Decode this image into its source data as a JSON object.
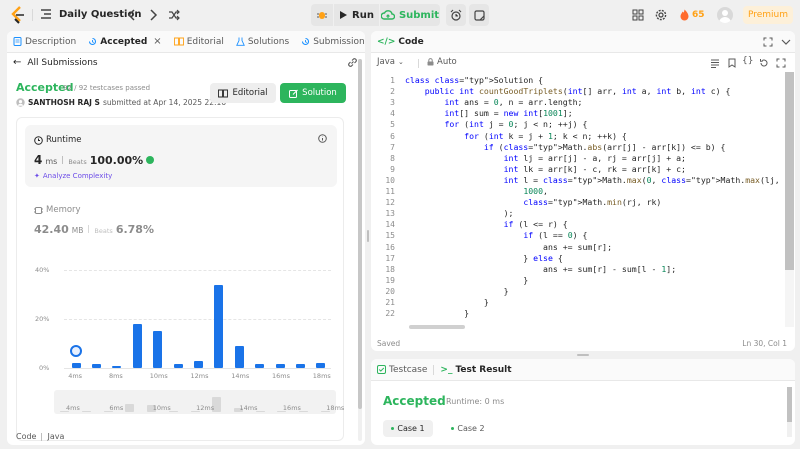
{
  "header": {
    "title": "Daily Question",
    "run_label": "Run",
    "submit_label": "Submit",
    "streak": "65",
    "premium_label": "Premium",
    "accent": "#ffa116"
  },
  "left": {
    "tabs": [
      {
        "label": "Description"
      },
      {
        "label": "Accepted"
      },
      {
        "label": "Editorial"
      },
      {
        "label": "Solutions"
      },
      {
        "label": "Submissions"
      }
    ],
    "back_label": "All Submissions",
    "status": "Accepted",
    "passed": "92 / 92 testcases passed",
    "user": "SANTHOSH RAJ S",
    "submitted": "submitted at Apr 14, 2025 22:16",
    "editorial_btn": "Editorial",
    "solution_btn": "Solution",
    "runtime": {
      "label": "Runtime",
      "value": "4",
      "unit": "ms",
      "beats_label": "Beats",
      "beats": "100.00%",
      "analyze": "Analyze Complexity"
    },
    "memory": {
      "label": "Memory",
      "value": "42.40",
      "unit": "MB",
      "beats_label": "Beats",
      "beats": "6.78%"
    },
    "footer": {
      "code_label": "Code",
      "lang": "Java"
    }
  },
  "chart_data": {
    "type": "bar",
    "y_ticks": [
      "40%",
      "20%",
      "0%"
    ],
    "ylim": [
      0,
      40
    ],
    "x_ticks": [
      "4ms",
      "8ms",
      "10ms",
      "12ms",
      "14ms",
      "16ms",
      "18ms"
    ],
    "values": [
      2,
      1.5,
      1,
      18,
      15,
      1.5,
      3,
      34,
      9,
      1.5,
      1.5,
      1.5,
      2
    ],
    "highlight_index": 0,
    "brush_ticks": [
      "4ms",
      "6ms",
      "10ms",
      "12ms",
      "14ms",
      "16ms",
      "18ms"
    ],
    "bar_color": "#1a73e8"
  },
  "code": {
    "title": "Code",
    "lang": "Java",
    "mode": "Auto",
    "lines": [
      "class Solution {",
      "    public int countGoodTriplets(int[] arr, int a, int b, int c) {",
      "        int ans = 0, n = arr.length;",
      "        int[] sum = new int[1001];",
      "        for (int j = 0; j < n; ++j) {",
      "            for (int k = j + 1; k < n; ++k) {",
      "                if (Math.abs(arr[j] - arr[k]) <= b) {",
      "                    int lj = arr[j] - a, rj = arr[j] + a;",
      "                    int lk = arr[k] - c, rk = arr[k] + c;",
      "                    int l = Math.max(0, Math.max(lj, lk)), r = Math.min(",
      "                        1000,",
      "                        Math.min(rj, rk)",
      "                    );",
      "                    if (l <= r) {",
      "                        if (l == 0) {",
      "                            ans += sum[r];",
      "                        } else {",
      "                            ans += sum[r] - sum[l - 1];",
      "                        }",
      "                    }",
      "                }",
      "            }"
    ],
    "saved": "Saved",
    "position": "Ln 30, Col 1"
  },
  "result": {
    "testcase_tab": "Testcase",
    "result_tab": "Test Result",
    "status": "Accepted",
    "runtime": "Runtime: 0 ms",
    "cases": [
      "Case 1",
      "Case 2"
    ]
  }
}
